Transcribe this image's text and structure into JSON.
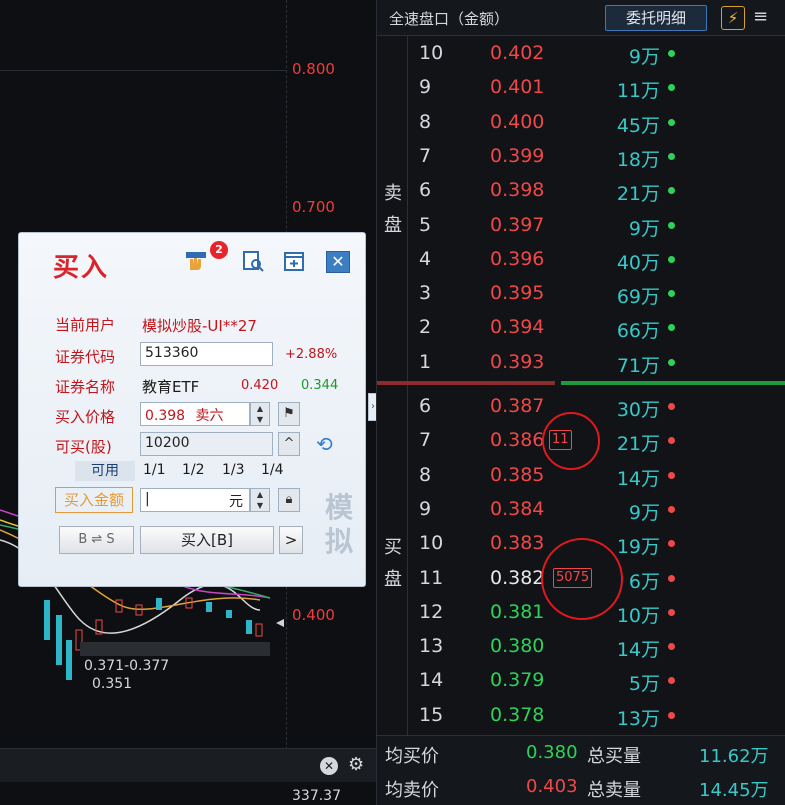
{
  "chart": {
    "price_labels": [
      "0.800",
      "0.700",
      "0.400"
    ],
    "bottom_value": "337.37",
    "range_label": "0.371-0.377",
    "low_label": "0.351"
  },
  "dialog": {
    "title": "买入",
    "badge": "2",
    "close": "✕",
    "fields": {
      "user_label": "当前用户",
      "user_value": "模拟炒股-UI**27",
      "code_label": "证券代码",
      "code_value": "513360",
      "code_change": "+2.88%",
      "name_label": "证券名称",
      "name_value": "教育ETF",
      "name_high": "0.420",
      "name_low": "0.344",
      "price_label": "买入价格",
      "price_value": "0.398",
      "price_level": "卖六",
      "qty_label": "可买(股)",
      "qty_value": "10200",
      "avail_label": "可用",
      "fractions": [
        "1/1",
        "1/2",
        "1/3",
        "1/4"
      ],
      "amount_label": "买入金额",
      "amount_value": "|",
      "amount_unit": "元"
    },
    "bs_switch": "B ⇌ S",
    "buy_button": "买入[B]",
    "more_button": ">",
    "watermark": "模拟"
  },
  "book": {
    "title": "全速盘口（金额）",
    "detail_button": "委托明细",
    "flash_icon": "⚡",
    "menu_icon": "≡",
    "sell_label": [
      "卖",
      "盘"
    ],
    "buy_label": [
      "买",
      "盘"
    ],
    "asks": [
      {
        "level": "10",
        "price": "0.402",
        "vol": "9万"
      },
      {
        "level": "9",
        "price": "0.401",
        "vol": "11万"
      },
      {
        "level": "8",
        "price": "0.400",
        "vol": "45万"
      },
      {
        "level": "7",
        "price": "0.399",
        "vol": "18万"
      },
      {
        "level": "6",
        "price": "0.398",
        "vol": "21万"
      },
      {
        "level": "5",
        "price": "0.397",
        "vol": "9万"
      },
      {
        "level": "4",
        "price": "0.396",
        "vol": "40万"
      },
      {
        "level": "3",
        "price": "0.395",
        "vol": "69万"
      },
      {
        "level": "2",
        "price": "0.394",
        "vol": "66万"
      },
      {
        "level": "1",
        "price": "0.393",
        "vol": "71万"
      }
    ],
    "bids": [
      {
        "level": "6",
        "price": "0.387",
        "vol": "30万",
        "color": "red"
      },
      {
        "level": "7",
        "price": "0.386",
        "vol": "21万",
        "color": "red",
        "tag": "11"
      },
      {
        "level": "8",
        "price": "0.385",
        "vol": "14万",
        "color": "red"
      },
      {
        "level": "9",
        "price": "0.384",
        "vol": "9万",
        "color": "red"
      },
      {
        "level": "10",
        "price": "0.383",
        "vol": "19万",
        "color": "red"
      },
      {
        "level": "11",
        "price": "0.382",
        "vol": "6万",
        "color": "white",
        "tag": "5075"
      },
      {
        "level": "12",
        "price": "0.381",
        "vol": "10万",
        "color": "green"
      },
      {
        "level": "13",
        "price": "0.380",
        "vol": "14万",
        "color": "green"
      },
      {
        "level": "14",
        "price": "0.379",
        "vol": "5万",
        "color": "green"
      },
      {
        "level": "15",
        "price": "0.378",
        "vol": "13万",
        "color": "green"
      }
    ],
    "footer": {
      "avg_buy_label": "均买价",
      "avg_buy_price": "0.380",
      "total_buy_label": "总买量",
      "total_buy_value": "11.62万",
      "avg_sell_label": "均卖价",
      "avg_sell_price": "0.403",
      "total_sell_label": "总卖量",
      "total_sell_value": "14.45万"
    }
  },
  "colors": {
    "up": "#f04848",
    "down": "#2ed25a",
    "volume": "#37c8c8",
    "accent": "#d8242a"
  }
}
